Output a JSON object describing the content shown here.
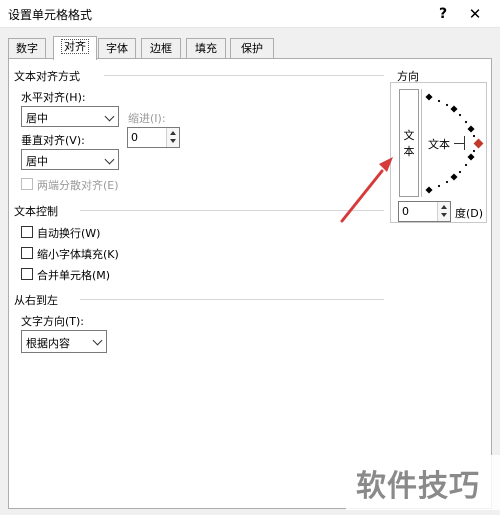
{
  "window": {
    "title": "设置单元格格式",
    "help_glyph": "?",
    "close_glyph": "✕"
  },
  "tabs": [
    {
      "label": "数字"
    },
    {
      "label": "对齐"
    },
    {
      "label": "字体"
    },
    {
      "label": "边框"
    },
    {
      "label": "填充"
    },
    {
      "label": "保护"
    }
  ],
  "active_tab": "对齐",
  "text_alignment": {
    "section": "文本对齐方式",
    "horizontal_label": "水平对齐(H):",
    "horizontal_value": "居中",
    "indent_label": "缩进(I):",
    "indent_value": "0",
    "vertical_label": "垂直对齐(V):",
    "vertical_value": "居中",
    "distributed_label": "两端分散对齐(E)"
  },
  "text_control": {
    "section": "文本控制",
    "wrap_label": "自动换行(W)",
    "shrink_label": "缩小字体填充(K)",
    "merge_label": "合并单元格(M)"
  },
  "rtl": {
    "section": "从右到左",
    "direction_label": "文字方向(T):",
    "direction_value": "根据内容"
  },
  "orientation": {
    "section": "方向",
    "vertical_text": "文本",
    "horizontal_text": "文本",
    "degrees_value": "0",
    "degrees_label": "度(D)"
  },
  "annotation": {
    "arrow_color": "#d63a3a"
  },
  "watermark": {
    "text": "软件技巧"
  },
  "colors": {
    "accent_red": "#c0392b",
    "arrow_red": "#d63a3a"
  }
}
